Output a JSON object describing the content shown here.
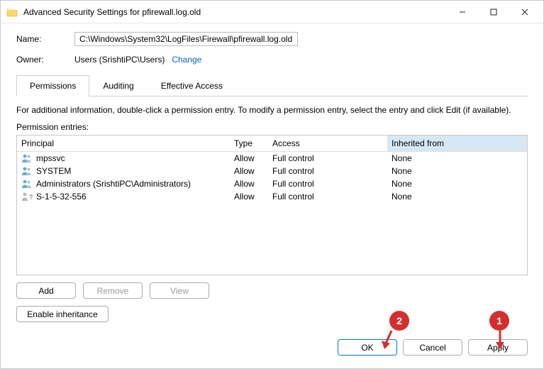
{
  "window": {
    "title": "Advanced Security Settings for pfirewall.log.old"
  },
  "fields": {
    "name_label": "Name:",
    "name_value": "C:\\Windows\\System32\\LogFiles\\Firewall\\pfirewall.log.old",
    "owner_label": "Owner:",
    "owner_value": "Users (SrishtiPC\\Users)",
    "change_link": "Change"
  },
  "tabs": {
    "permissions": "Permissions",
    "auditing": "Auditing",
    "effective": "Effective Access"
  },
  "info_text": "For additional information, double-click a permission entry. To modify a permission entry, select the entry and click Edit (if available).",
  "entries_label": "Permission entries:",
  "headers": {
    "principal": "Principal",
    "type": "Type",
    "access": "Access",
    "inherited": "Inherited from"
  },
  "entries": [
    {
      "principal": "mpssvc",
      "type": "Allow",
      "access": "Full control",
      "inherited": "None",
      "icon": "users"
    },
    {
      "principal": "SYSTEM",
      "type": "Allow",
      "access": "Full control",
      "inherited": "None",
      "icon": "users"
    },
    {
      "principal": "Administrators (SrishtiPC\\Administrators)",
      "type": "Allow",
      "access": "Full control",
      "inherited": "None",
      "icon": "users"
    },
    {
      "principal": "S-1-5-32-556",
      "type": "Allow",
      "access": "Full control",
      "inherited": "None",
      "icon": "unknown"
    }
  ],
  "buttons": {
    "add": "Add",
    "remove": "Remove",
    "view": "View",
    "enable_inheritance": "Enable inheritance",
    "ok": "OK",
    "cancel": "Cancel",
    "apply": "Apply"
  },
  "annotations": {
    "badge1": "1",
    "badge2": "2"
  }
}
